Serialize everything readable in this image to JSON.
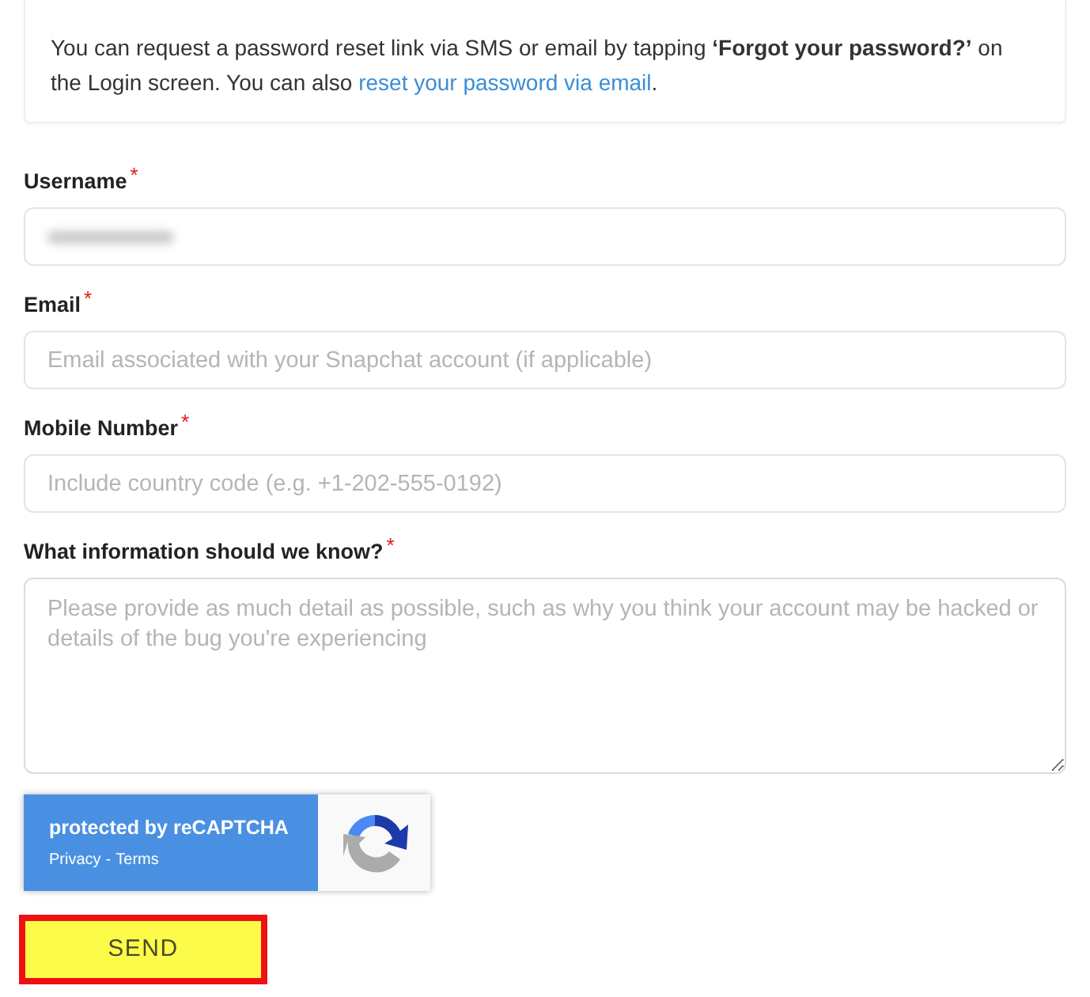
{
  "notice": {
    "text": "You can request a password reset link via SMS or email by tapping **‘Forgot your password?’** on the Login screen. You can also ",
    "link": "reset your password via email",
    "end": "."
  },
  "fields": [
    {
      "kind": "input",
      "label": "Username",
      "required_mark": "*",
      "value_blurred": true
    },
    {
      "kind": "input",
      "label": "Email",
      "required_mark": "*",
      "placeholder": "Email associated with your Snapchat account (if applicable)"
    },
    {
      "kind": "input",
      "label": "Mobile Number",
      "required_mark": "*",
      "placeholder": "Include country code (e.g. +1-202-555-0192)"
    },
    {
      "kind": "textarea",
      "label": "What information should we know?",
      "required_mark": "*",
      "placeholder": "Please provide as much detail as possible, such as why you think your account may be hacked or details of the bug you're experiencing"
    }
  ],
  "recaptcha": {
    "title": "protected by reCAPTCHA",
    "links": [
      "Privacy",
      "Terms"
    ],
    "separator": "-"
  },
  "submit": {
    "label": "SEND",
    "highlighted": true
  }
}
